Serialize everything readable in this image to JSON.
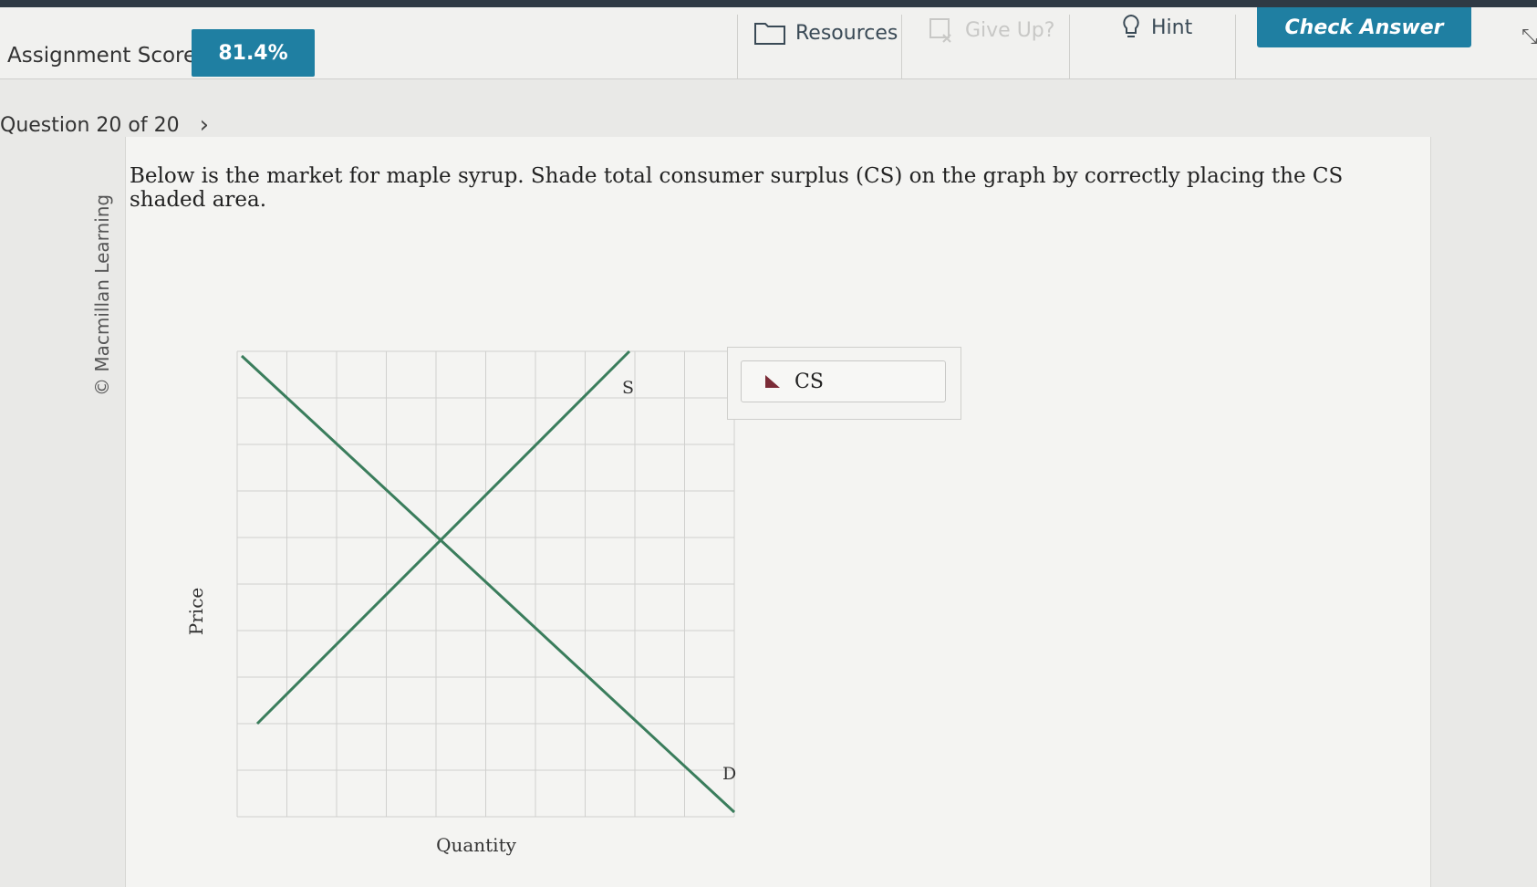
{
  "header": {
    "score_label": "Assignment Score:",
    "score_value": "81.4%",
    "resources_label": "Resources",
    "giveup_label": "Give Up?",
    "hint_label": "Hint",
    "check_answer_label": "Check Answer"
  },
  "question": {
    "nav_label": "Question 20 of 20",
    "prompt": "Below is the market for maple syrup. Shade total consumer surplus (CS) on the graph by correctly placing the CS shaded area.",
    "copyright": "© Macmillan Learning"
  },
  "graph": {
    "y_axis_label": "Price",
    "x_axis_label": "Quantity",
    "supply_label": "S",
    "demand_label": "D",
    "line_color": "#3a7d5c",
    "grid_color": "#d0d0ce"
  },
  "legend": {
    "cs_label": "CS",
    "cs_color": "#7a2b36"
  }
}
